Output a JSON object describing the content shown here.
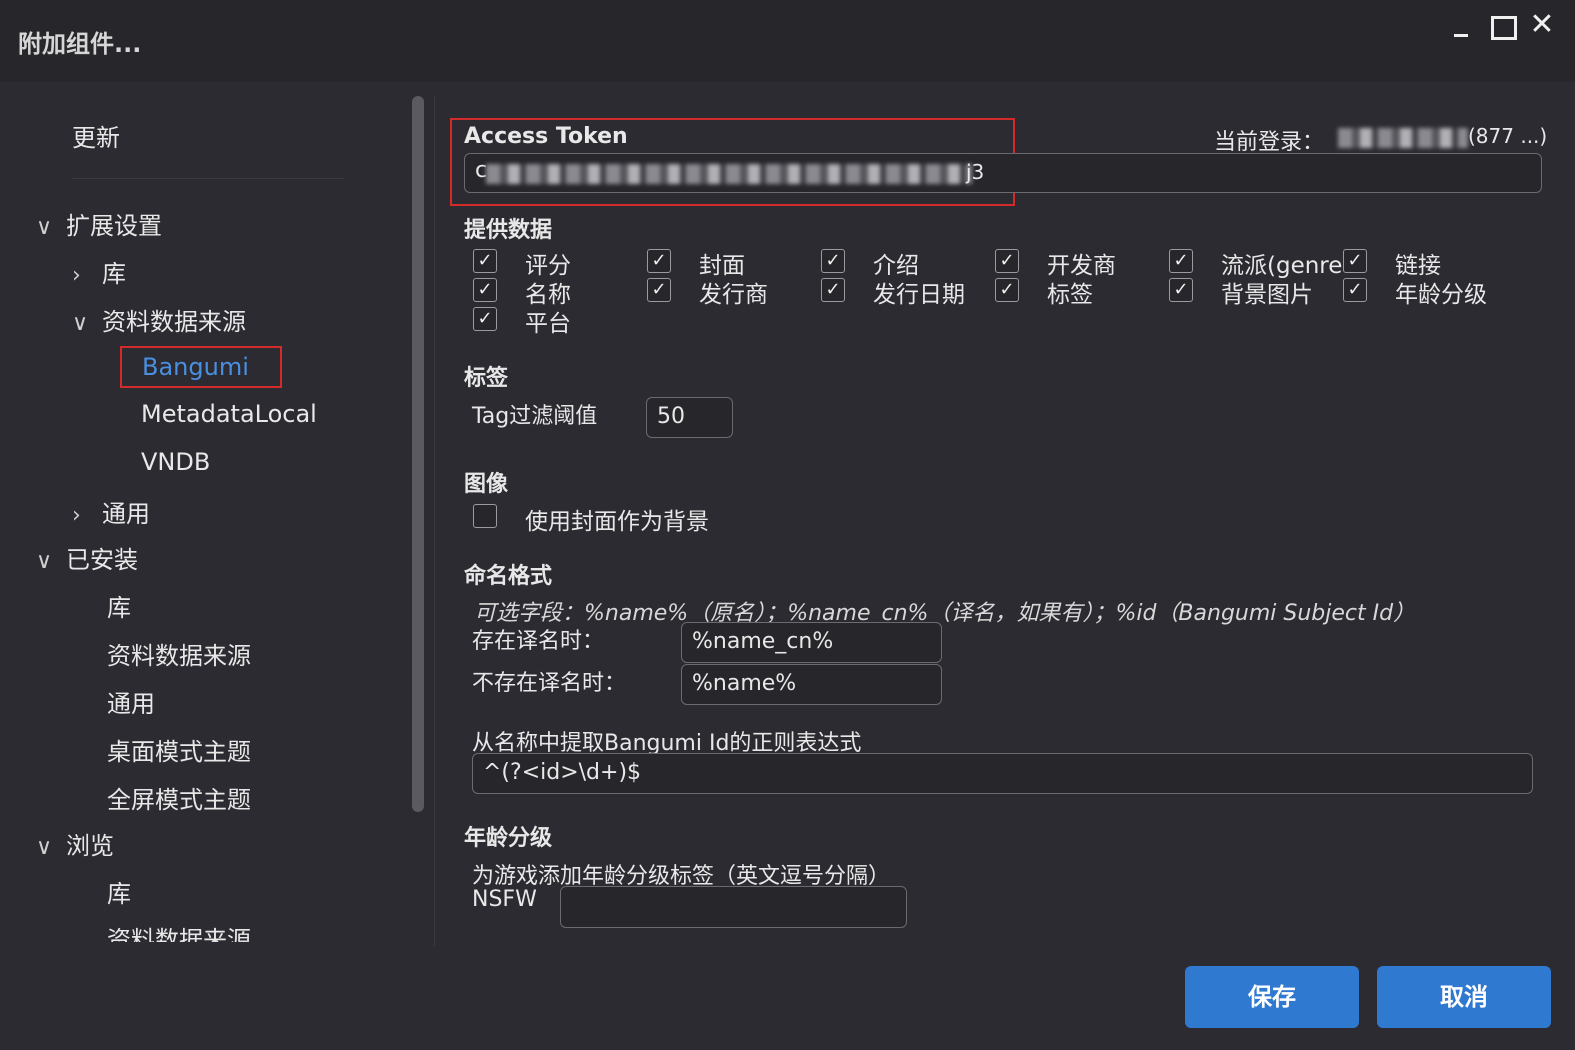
{
  "window": {
    "title": "附加组件...",
    "minimize": "minimize",
    "maximize": "maximize",
    "close": "✕"
  },
  "sidebar": {
    "update": "更新",
    "ext_settings": "扩展设置",
    "library": "库",
    "metadata_sources": "资料数据来源",
    "bangumi": "Bangumi",
    "metadata_local": "MetadataLocal",
    "vndb": "VNDB",
    "general": "通用",
    "installed": "已安装",
    "installed_library": "库",
    "installed_metadata": "资料数据来源",
    "installed_general": "通用",
    "desktop_theme": "桌面模式主题",
    "fullscreen_theme": "全屏模式主题",
    "browse": "浏览",
    "browse_library": "库",
    "browse_metadata": "资料数据来源"
  },
  "token": {
    "label": "Access Token",
    "value_start": "c",
    "value_end": "j3",
    "login_label": "当前登录：",
    "login_value_end": "(877 ...)"
  },
  "provide": {
    "title": "提供数据",
    "items": [
      {
        "label": "评分",
        "checked": true
      },
      {
        "label": "封面",
        "checked": true
      },
      {
        "label": "介绍",
        "checked": true
      },
      {
        "label": "开发商",
        "checked": true
      },
      {
        "label": "流派(genre",
        "checked": true
      },
      {
        "label": "链接",
        "checked": true
      },
      {
        "label": "名称",
        "checked": true
      },
      {
        "label": "发行商",
        "checked": true
      },
      {
        "label": "发行日期",
        "checked": true
      },
      {
        "label": "标签",
        "checked": true
      },
      {
        "label": "背景图片",
        "checked": true
      },
      {
        "label": "年龄分级",
        "checked": true
      },
      {
        "label": "平台",
        "checked": true
      }
    ]
  },
  "tags": {
    "title": "标签",
    "threshold_label": "Tag过滤阈值",
    "threshold_value": "50"
  },
  "image": {
    "title": "图像",
    "use_cover_label": "使用封面作为背景",
    "use_cover_checked": false
  },
  "naming": {
    "title": "命名格式",
    "hint": "可选字段：%name%（原名）；%name_cn%（译名，如果有）；%id（Bangumi Subject Id）",
    "has_cn_label": "存在译名时：",
    "has_cn_value": "%name_cn%",
    "no_cn_label": "不存在译名时：",
    "no_cn_value": "%name%",
    "regex_label": "从名称中提取Bangumi Id的正则表达式",
    "regex_value": "^(?<id>\\d+)$"
  },
  "age": {
    "title": "年龄分级",
    "desc": "为游戏添加年龄分级标签（英文逗号分隔）",
    "nsfw_label": "NSFW",
    "nsfw_value": ""
  },
  "buttons": {
    "save": "保存",
    "cancel": "取消"
  },
  "colors": {
    "background": "#2b2b31",
    "accent": "#2f79d0",
    "highlight": "#d32a2a",
    "selected_text": "#4a8fe0"
  }
}
